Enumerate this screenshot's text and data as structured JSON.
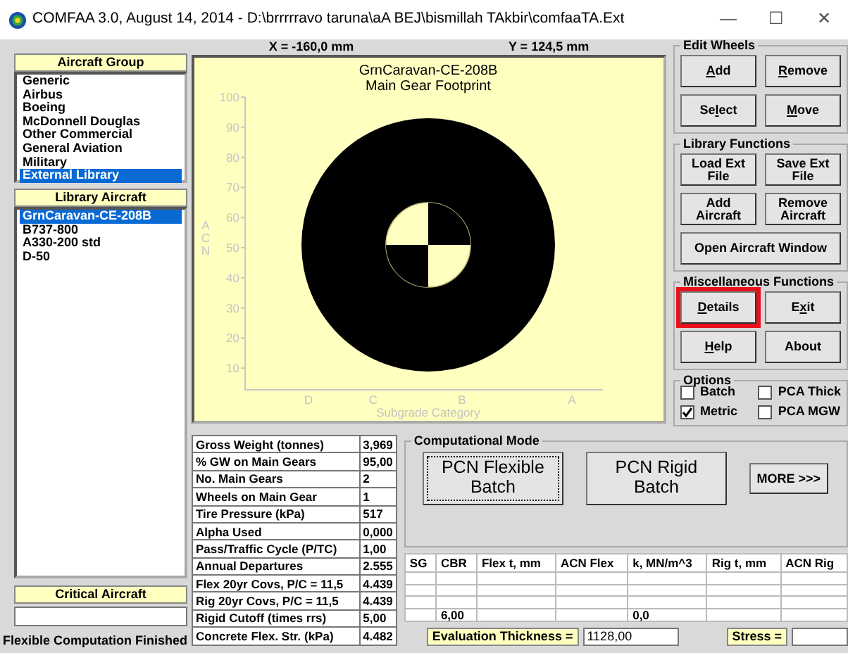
{
  "window": {
    "title": "COMFAA 3.0, August 14, 2014 - D:\\brrrrravo taruna\\aA BEJ\\bismillah TAkbir\\comfaaTA.Ext",
    "controls": [
      "—",
      "☐",
      "✕"
    ]
  },
  "aircraft_group": {
    "header": "Aircraft Group",
    "items": [
      {
        "label": "Generic",
        "selected": false
      },
      {
        "label": "Airbus",
        "selected": false
      },
      {
        "label": "Boeing",
        "selected": false
      },
      {
        "label": "McDonnell Douglas",
        "selected": false
      },
      {
        "label": "Other Commercial",
        "selected": false
      },
      {
        "label": "General Aviation",
        "selected": false
      },
      {
        "label": "Military",
        "selected": false
      },
      {
        "label": "External Library",
        "selected": true
      }
    ]
  },
  "library_aircraft": {
    "header": "Library Aircraft",
    "items": [
      {
        "label": "GrnCaravan-CE-208B",
        "selected": true
      },
      {
        "label": "B737-800",
        "selected": false
      },
      {
        "label": "A330-200 std",
        "selected": false
      },
      {
        "label": "D-50",
        "selected": false
      }
    ]
  },
  "critical_aircraft": {
    "header": "Critical Aircraft"
  },
  "status": "Flexible Computation Finished",
  "coordinates": {
    "x": "X = -160,0 mm",
    "y": "Y = 124,5 mm"
  },
  "footprint": {
    "title": [
      "GrnCaravan-CE-208B",
      "Main Gear Footprint"
    ],
    "y_ticks": [
      "100",
      "90",
      "80",
      "70",
      "60",
      "50",
      "40",
      "30",
      "20",
      "10"
    ],
    "y_label": [
      "A",
      "C",
      "N"
    ],
    "x_ticks": [
      "D",
      "C",
      "B",
      "A"
    ],
    "x_label": "Subgrade Category"
  },
  "edit_wheels": {
    "title": "Edit Wheels",
    "buttons": [
      {
        "label": {
          "key": "A",
          "after": "dd"
        },
        "highlighted": false
      },
      {
        "label": {
          "key": "R",
          "after": "emove"
        },
        "highlighted": false
      },
      {
        "label": {
          "before": "Se",
          "key": "l",
          "after": "ect"
        },
        "highlighted": false
      },
      {
        "label": {
          "key": "M",
          "after": "ove"
        },
        "highlighted": false
      }
    ]
  },
  "library_functions": {
    "title": "Library Functions",
    "buttons": [
      {
        "label": "Load Ext File",
        "highlighted": false
      },
      {
        "label": "Save Ext File",
        "highlighted": false
      },
      {
        "label": "Add Aircraft",
        "highlighted": false
      },
      {
        "label": "Remove Aircraft",
        "highlighted": false
      }
    ],
    "wide_button": "Open Aircraft Window"
  },
  "misc_functions": {
    "title": "Miscellaneous Functions",
    "buttons": [
      {
        "label": {
          "key": "D",
          "after": "etails"
        },
        "highlighted": true
      },
      {
        "label": {
          "before": "E",
          "key": "x",
          "after": "it"
        },
        "highlighted": false
      },
      {
        "label": {
          "key": "H",
          "after": "elp"
        },
        "highlighted": false
      },
      {
        "label": "About",
        "highlighted": false
      }
    ]
  },
  "options": {
    "title": "Options",
    "checkboxes": [
      {
        "label": "Batch",
        "checked": false
      },
      {
        "label": "PCA Thick",
        "checked": false
      },
      {
        "label": "Metric",
        "checked": true
      },
      {
        "label": "PCA MGW",
        "checked": false
      }
    ]
  },
  "parameters": [
    [
      "Gross Weight (tonnes)",
      "3,969"
    ],
    [
      "% GW on Main Gears",
      "95,00"
    ],
    [
      "No. Main Gears",
      "2"
    ],
    [
      "Wheels on Main Gear",
      "1"
    ],
    [
      "Tire Pressure (kPa)",
      "517"
    ],
    [
      "Alpha Used",
      "0,000"
    ],
    [
      "Pass/Traffic Cycle (P/TC)",
      "1,00"
    ],
    [
      "Annual Departures",
      "2.555"
    ],
    [
      "Flex 20yr Covs, P/C = 11,5",
      "4.439"
    ],
    [
      "Rig 20yr Covs,  P/C = 11,5",
      "4.439"
    ],
    [
      "Rigid Cutoff (times rrs)",
      "5,00"
    ],
    [
      "Concrete Flex. Str. (kPa)",
      "4.482"
    ]
  ],
  "computational_mode": {
    "title": "Computational Mode",
    "buttons": [
      {
        "label": "PCN Flexible Batch",
        "focused": true
      },
      {
        "label": "PCN Rigid Batch",
        "focused": false
      }
    ],
    "more": "MORE >>>"
  },
  "results": {
    "columns": [
      "SG",
      "CBR",
      "Flex t, mm",
      "ACN Flex",
      "k, MN/m^3",
      "Rig t, mm",
      "ACN Rig"
    ],
    "rows": [
      [
        null,
        null,
        null,
        null,
        null,
        null,
        null
      ],
      [
        null,
        null,
        null,
        null,
        null,
        null,
        null
      ],
      [
        null,
        null,
        null,
        null,
        null,
        null,
        null
      ],
      [
        null,
        "6,00",
        null,
        null,
        "0,0",
        null,
        null
      ]
    ]
  },
  "evaluation": {
    "label": "Evaluation Thickness =",
    "value": "1128,00"
  },
  "stress": {
    "label": "Stress ="
  }
}
